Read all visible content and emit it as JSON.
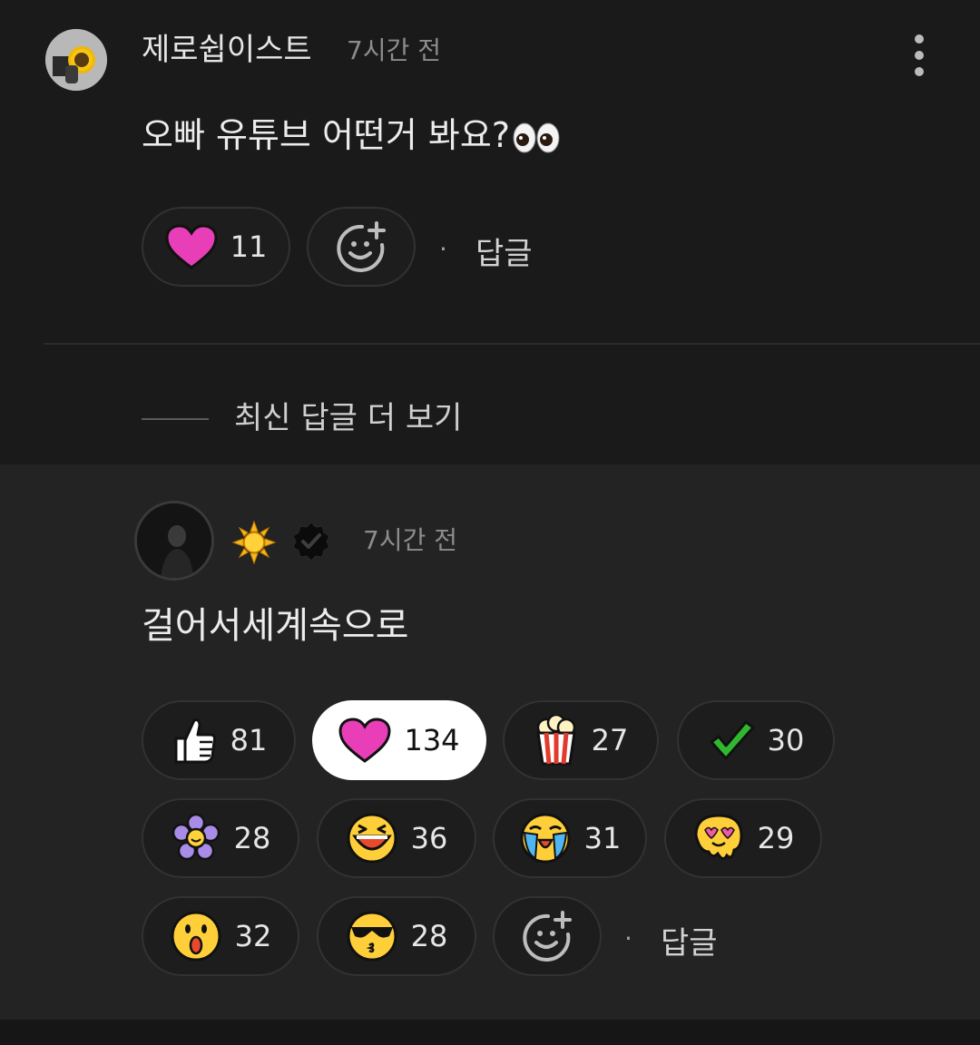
{
  "comment": {
    "author": "제로쉽이스트",
    "time": "7시간 전",
    "text": "오빠 유튜브 어떤거 봐요?",
    "text_emoji": "eyes-emoji",
    "reactions": [
      {
        "icon": "heart-icon",
        "count": "11"
      }
    ],
    "reply_label": "답글",
    "separator": "·"
  },
  "more_replies": {
    "label": "최신 답글 더 보기"
  },
  "reply": {
    "author_icons": [
      "sun-emoji",
      "verified-badge-icon"
    ],
    "time": "7시간 전",
    "text": "걸어서세계속으로",
    "reactions": [
      {
        "icon": "thumbs-up-icon",
        "count": "81"
      },
      {
        "icon": "heart-icon",
        "count": "134",
        "selected": true
      },
      {
        "icon": "popcorn-icon",
        "count": "27"
      },
      {
        "icon": "check-icon",
        "count": "30"
      },
      {
        "icon": "flower-icon",
        "count": "28"
      },
      {
        "icon": "laughing-face-icon",
        "count": "36"
      },
      {
        "icon": "crying-face-icon",
        "count": "31"
      },
      {
        "icon": "heart-eyes-melting-face-icon",
        "count": "29"
      },
      {
        "icon": "surprised-face-icon",
        "count": "32"
      },
      {
        "icon": "sunglasses-kiss-face-icon",
        "count": "28"
      }
    ],
    "reply_label": "답글",
    "separator": "·"
  },
  "colors": {
    "background": "#1a1a1a",
    "reply_background": "#232323",
    "heart": "#e83fb8",
    "check": "#2fb82f"
  }
}
